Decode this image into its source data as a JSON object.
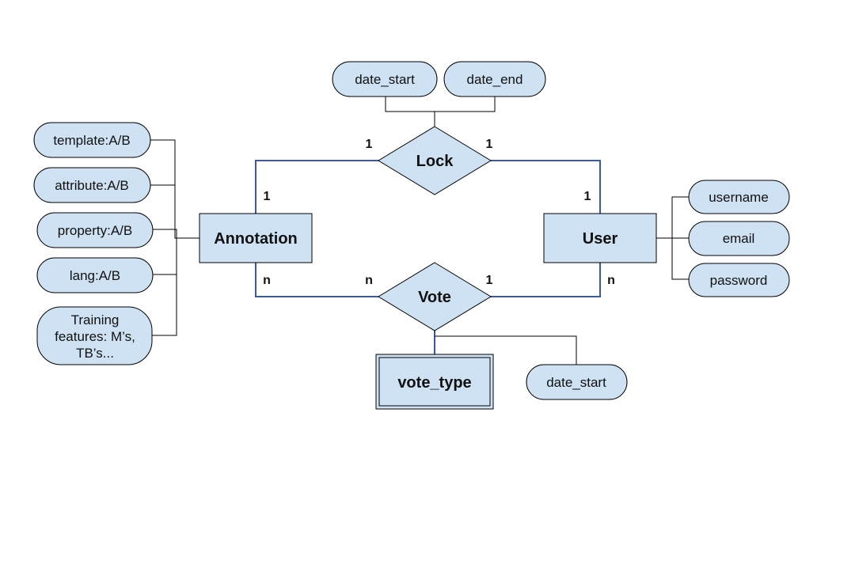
{
  "colors": {
    "shape_fill": "#cfe2f3",
    "relationship_line": "#3c5a96",
    "attribute_line": "#000000"
  },
  "entities": {
    "annotation": {
      "label": "Annotation"
    },
    "user": {
      "label": "User"
    },
    "vote_type": {
      "label": "vote_type",
      "weak": true
    }
  },
  "relationships": {
    "lock": {
      "label": "Lock",
      "card_annotation_side": "1",
      "card_user_side": "1",
      "card_annotation": "1",
      "card_user": "1"
    },
    "vote": {
      "label": "Vote",
      "card_annotation_side": "n",
      "card_user_side": "1",
      "card_annotation": "n",
      "card_user": "n"
    }
  },
  "lock_attributes": [
    "date_start",
    "date_end"
  ],
  "annotation_attributes": [
    "template:A/B",
    "attribute:A/B",
    "property:A/B",
    "lang:A/B",
    [
      "Training",
      "features: M’s,",
      "TB’s..."
    ]
  ],
  "user_attributes": [
    "username",
    "email",
    "password"
  ],
  "vote_attributes": [
    "date_start"
  ]
}
